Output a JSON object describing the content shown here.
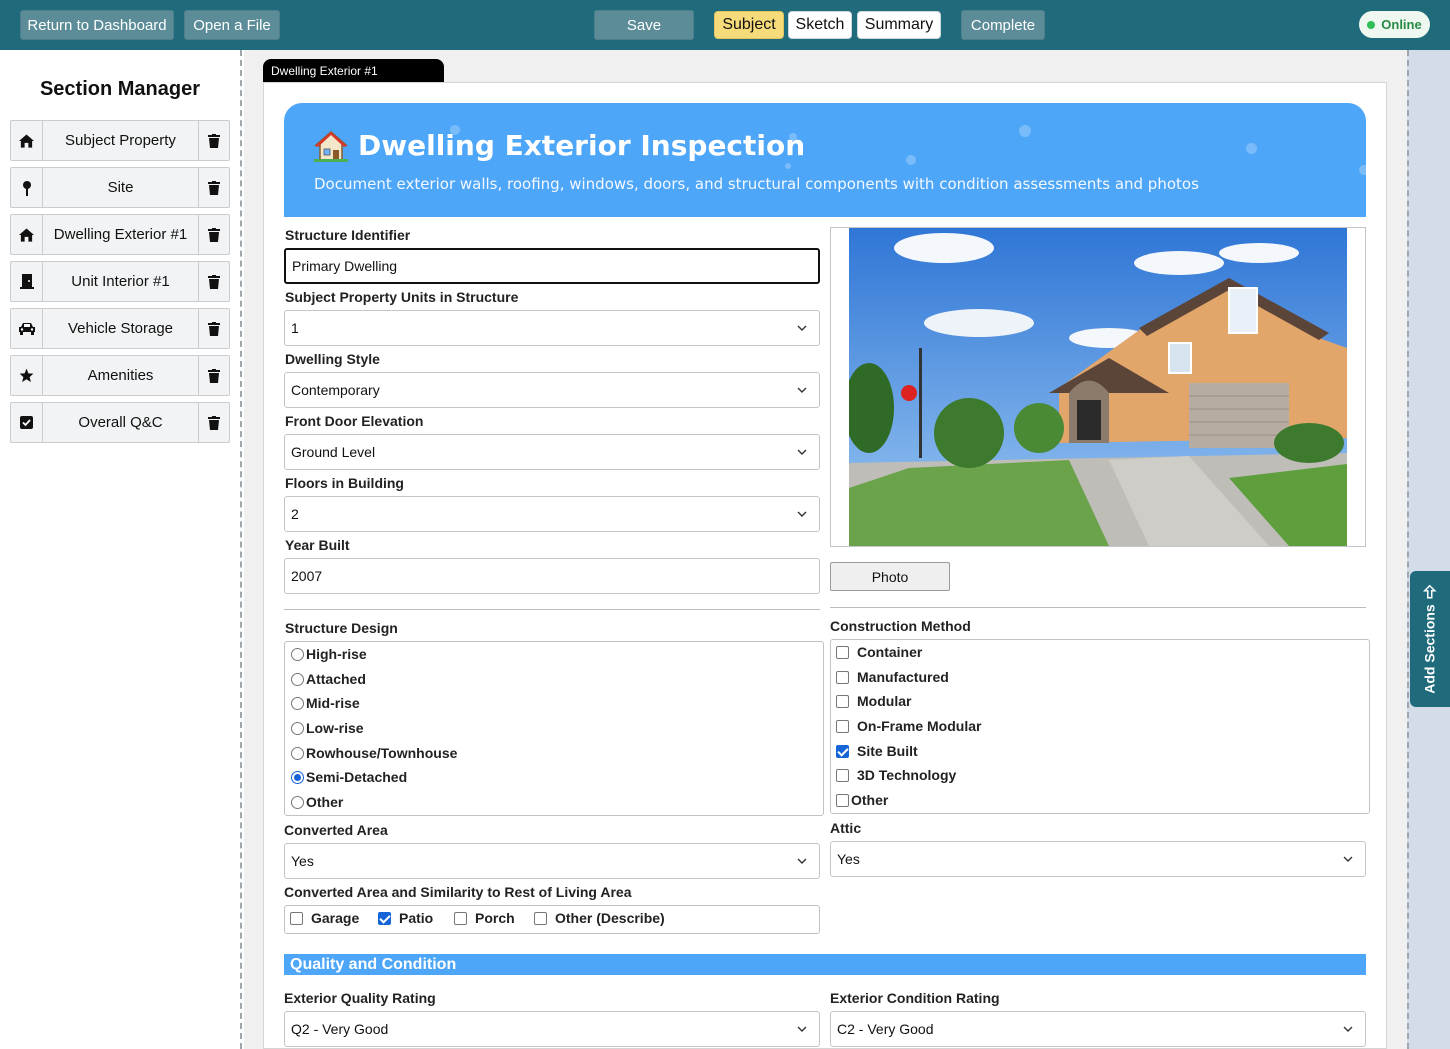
{
  "topbar": {
    "return_label": "Return to Dashboard",
    "open_label": "Open a File",
    "save_label": "Save",
    "tabs": [
      "Subject",
      "Sketch",
      "Summary"
    ],
    "active_tab": "Subject",
    "complete_label": "Complete",
    "status": "Online"
  },
  "sidebar": {
    "title": "Section Manager",
    "items": [
      {
        "label": "Subject Property",
        "icon": "home-icon"
      },
      {
        "label": "Site",
        "icon": "map-pin-icon"
      },
      {
        "label": "Dwelling Exterior #1",
        "icon": "home-icon"
      },
      {
        "label": "Unit Interior #1",
        "icon": "door-icon"
      },
      {
        "label": "Vehicle Storage",
        "icon": "car-icon"
      },
      {
        "label": "Amenities",
        "icon": "star-icon"
      },
      {
        "label": "Overall Q&C",
        "icon": "check-square-icon"
      }
    ]
  },
  "doc_tab": "Dwelling Exterior #1",
  "hero": {
    "title": "Dwelling Exterior Inspection",
    "subtitle": "Document exterior walls, roofing, windows, doors, and structural components with condition assessments and photos"
  },
  "form": {
    "structure_identifier": {
      "label": "Structure Identifier",
      "value": "Primary Dwelling"
    },
    "units_in_structure": {
      "label": "Subject Property Units in Structure",
      "value": "1"
    },
    "dwelling_style": {
      "label": "Dwelling Style",
      "value": "Contemporary"
    },
    "front_door_elevation": {
      "label": "Front Door Elevation",
      "value": "Ground Level"
    },
    "floors_in_building": {
      "label": "Floors in Building",
      "value": "2"
    },
    "year_built": {
      "label": "Year Built",
      "value": "2007"
    },
    "photo_button": "Photo",
    "structure_design": {
      "label": "Structure Design",
      "options": [
        "High-rise",
        "Attached",
        "Mid-rise",
        "Low-rise",
        "Rowhouse/Townhouse",
        "Semi-Detached",
        "Other"
      ],
      "selected": "Semi-Detached"
    },
    "construction_method": {
      "label": "Construction Method",
      "options": [
        "Container",
        "Manufactured",
        "Modular",
        "On-Frame Modular",
        "Site Built",
        "3D Technology",
        "Other"
      ],
      "checked": [
        "Site Built"
      ]
    },
    "converted_area": {
      "label": "Converted Area",
      "value": "Yes"
    },
    "attic": {
      "label": "Attic",
      "value": "Yes"
    },
    "converted_similarity": {
      "label": "Converted Area and Similarity to Rest of Living Area",
      "options": [
        "Garage",
        "Patio",
        "Porch",
        "Other (Describe)"
      ],
      "checked": [
        "Patio"
      ]
    }
  },
  "quality_condition": {
    "heading": "Quality and Condition",
    "exterior_quality": {
      "label": "Exterior Quality Rating",
      "value": "Q2 - Very Good"
    },
    "exterior_condition": {
      "label": "Exterior Condition Rating",
      "value": "C2 - Very Good"
    }
  },
  "add_sections_label": "Add Sections",
  "colors": {
    "topbar": "#1f6b7c",
    "accent": "#4ea6f8",
    "active_tab": "#f6db7a",
    "online": "#2fbf57"
  }
}
